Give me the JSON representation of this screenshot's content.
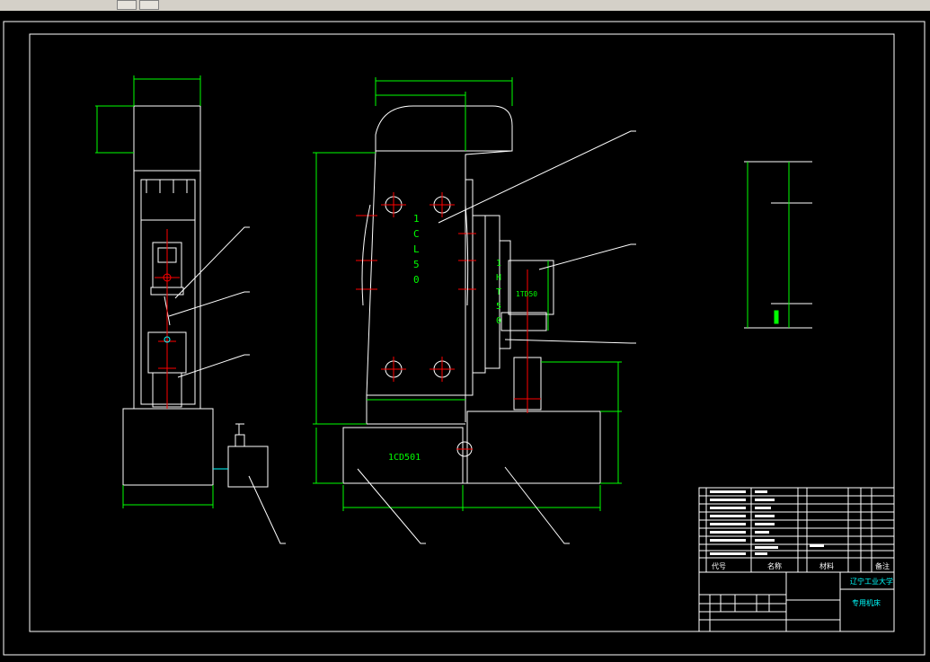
{
  "colors": {
    "background": "#000000",
    "outline": "#ffffff",
    "dimension": "#00ff00",
    "centerline": "#ff0000",
    "highlight": "#00ffff"
  },
  "main_view": {
    "column_label": "1CL50",
    "head_label": "1HT50",
    "base_label": "1CD501",
    "head_small_label": "1TD50"
  },
  "title_block": {
    "header_code": "代号",
    "header_name": "名称",
    "header_material": "材料",
    "header_note": "备注",
    "school": "辽宁工业大学",
    "drawing_name": "专用机床"
  }
}
